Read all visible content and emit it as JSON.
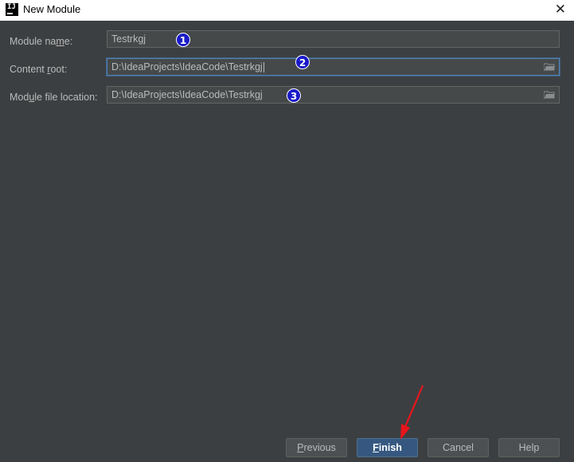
{
  "window": {
    "title": "New Module",
    "icon_text": "IJ",
    "close_glyph": "✕"
  },
  "form": {
    "module_name": {
      "label": "Module name:",
      "mnemonic": "m",
      "value": "Testrkgj",
      "badge": "1"
    },
    "content_root": {
      "label": "Content root:",
      "mnemonic": "r",
      "value": "D:\\IdeaProjects\\IdeaCode\\Testrkgj",
      "badge": "2"
    },
    "module_file_location": {
      "label": "Module file location:",
      "mnemonic": "u",
      "value": "D:\\IdeaProjects\\IdeaCode\\Testrkgj",
      "badge": "3"
    }
  },
  "buttons": {
    "previous": "Previous",
    "finish": "Finish",
    "cancel": "Cancel",
    "help": "Help"
  },
  "colors": {
    "background": "#3c3f41",
    "field_bg": "#45494a",
    "accent": "#365880",
    "badge": "#1a1ac8",
    "annotation_arrow": "#e8151b"
  },
  "icons": {
    "browse": "folder-icon",
    "annotation": "red-arrow"
  }
}
